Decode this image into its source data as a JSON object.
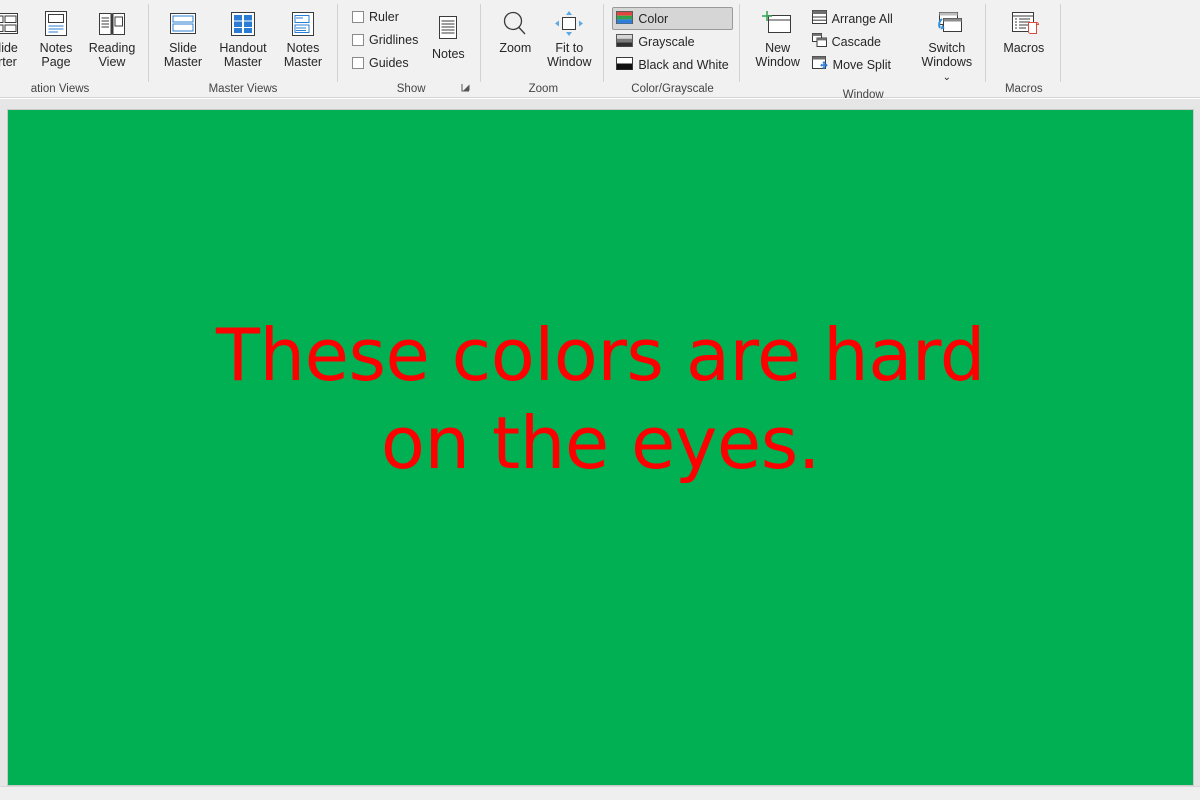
{
  "app": "PowerPoint",
  "ribbon": {
    "groups": [
      {
        "name": "presentation-views",
        "label": "ation Views",
        "items": [
          {
            "label_line1": "Slide",
            "label_line2": "orter",
            "icon": "slide-sorter-icon"
          },
          {
            "label_line1": "Notes",
            "label_line2": "Page",
            "icon": "notes-page-icon"
          },
          {
            "label_line1": "Reading",
            "label_line2": "View",
            "icon": "reading-view-icon"
          }
        ]
      },
      {
        "name": "master-views",
        "label": "Master Views",
        "items": [
          {
            "label_line1": "Slide",
            "label_line2": "Master",
            "icon": "slide-master-icon"
          },
          {
            "label_line1": "Handout",
            "label_line2": "Master",
            "icon": "handout-master-icon"
          },
          {
            "label_line1": "Notes",
            "label_line2": "Master",
            "icon": "notes-master-icon"
          }
        ]
      },
      {
        "name": "show",
        "label": "Show",
        "has_dialog_launcher": true,
        "checkboxes": [
          {
            "label": "Ruler",
            "checked": false
          },
          {
            "label": "Gridlines",
            "checked": false
          },
          {
            "label": "Guides",
            "checked": false
          }
        ],
        "items": [
          {
            "label_line1": "Notes",
            "label_line2": "",
            "icon": "notes-icon"
          }
        ]
      },
      {
        "name": "zoom",
        "label": "Zoom",
        "items": [
          {
            "label_line1": "Zoom",
            "label_line2": "",
            "icon": "magnifier-icon"
          },
          {
            "label_line1": "Fit to",
            "label_line2": "Window",
            "icon": "fit-to-window-icon"
          }
        ]
      },
      {
        "name": "color-grayscale",
        "label": "Color/Grayscale",
        "options": [
          {
            "label": "Color",
            "icon": "color-swatch-icon",
            "selected": true
          },
          {
            "label": "Grayscale",
            "icon": "grayscale-swatch-icon",
            "selected": false
          },
          {
            "label": "Black and White",
            "icon": "blackwhite-swatch-icon",
            "selected": false
          }
        ]
      },
      {
        "name": "window",
        "label": "Window",
        "items": [
          {
            "label_line1": "New",
            "label_line2": "Window",
            "icon": "new-window-icon"
          },
          {
            "label_line1": "Switch",
            "label_line2": "Windows",
            "icon": "switch-windows-icon",
            "has_chevron": true
          }
        ],
        "commands": [
          {
            "label": "Arrange All",
            "icon": "arrange-all-icon"
          },
          {
            "label": "Cascade",
            "icon": "cascade-icon"
          },
          {
            "label": "Move Split",
            "icon": "move-split-icon"
          }
        ]
      },
      {
        "name": "macros",
        "label": "Macros",
        "items": [
          {
            "label_line1": "Macros",
            "label_line2": "",
            "icon": "macros-icon"
          }
        ]
      }
    ]
  },
  "slide": {
    "background_color": "#00b052",
    "text_color": "#ff0000",
    "text": "These colors are hard on the eyes."
  }
}
